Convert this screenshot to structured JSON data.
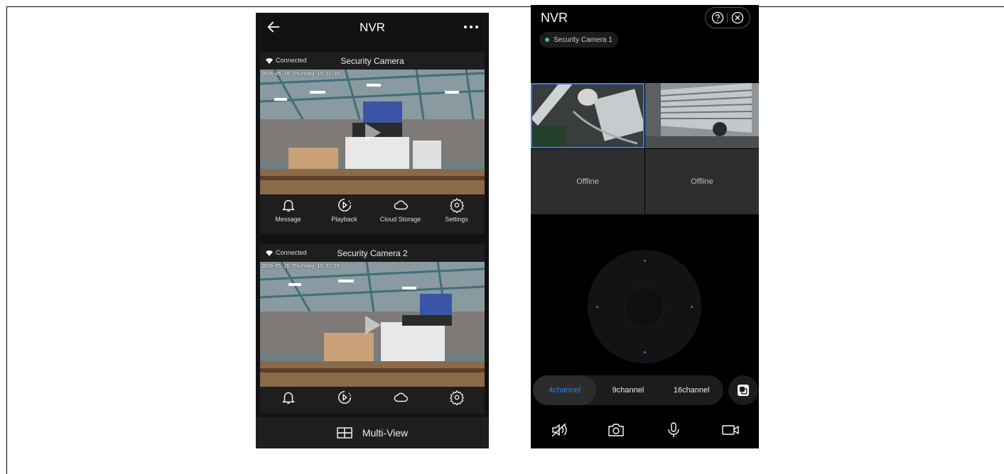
{
  "left_screen": {
    "title": "NVR",
    "cameras": [
      {
        "status": "Connected",
        "name": "Security Camera",
        "osd": "2020-05-28 Thursday 19:22:30",
        "actions": [
          "Message",
          "Playback",
          "Cloud Storage",
          "Settings"
        ]
      },
      {
        "status": "Connected",
        "name": "Security Camera 2",
        "osd": "2020-05-28 Thursday 19:22:29"
      }
    ],
    "multiview_label": "Multi-View"
  },
  "right_screen": {
    "title": "NVR",
    "chip_label": "Security Camera  1",
    "tiles": [
      {
        "state": "feed"
      },
      {
        "state": "feed"
      },
      {
        "label": "Offline"
      },
      {
        "label": "Offline"
      }
    ],
    "channels": [
      "4channel",
      "9channel",
      "16channel"
    ],
    "active_channel": "4channel"
  },
  "colors": {
    "accent_blue": "#2f7fe0",
    "online_green": "#2ecc71",
    "bg_dark": "#121212"
  }
}
